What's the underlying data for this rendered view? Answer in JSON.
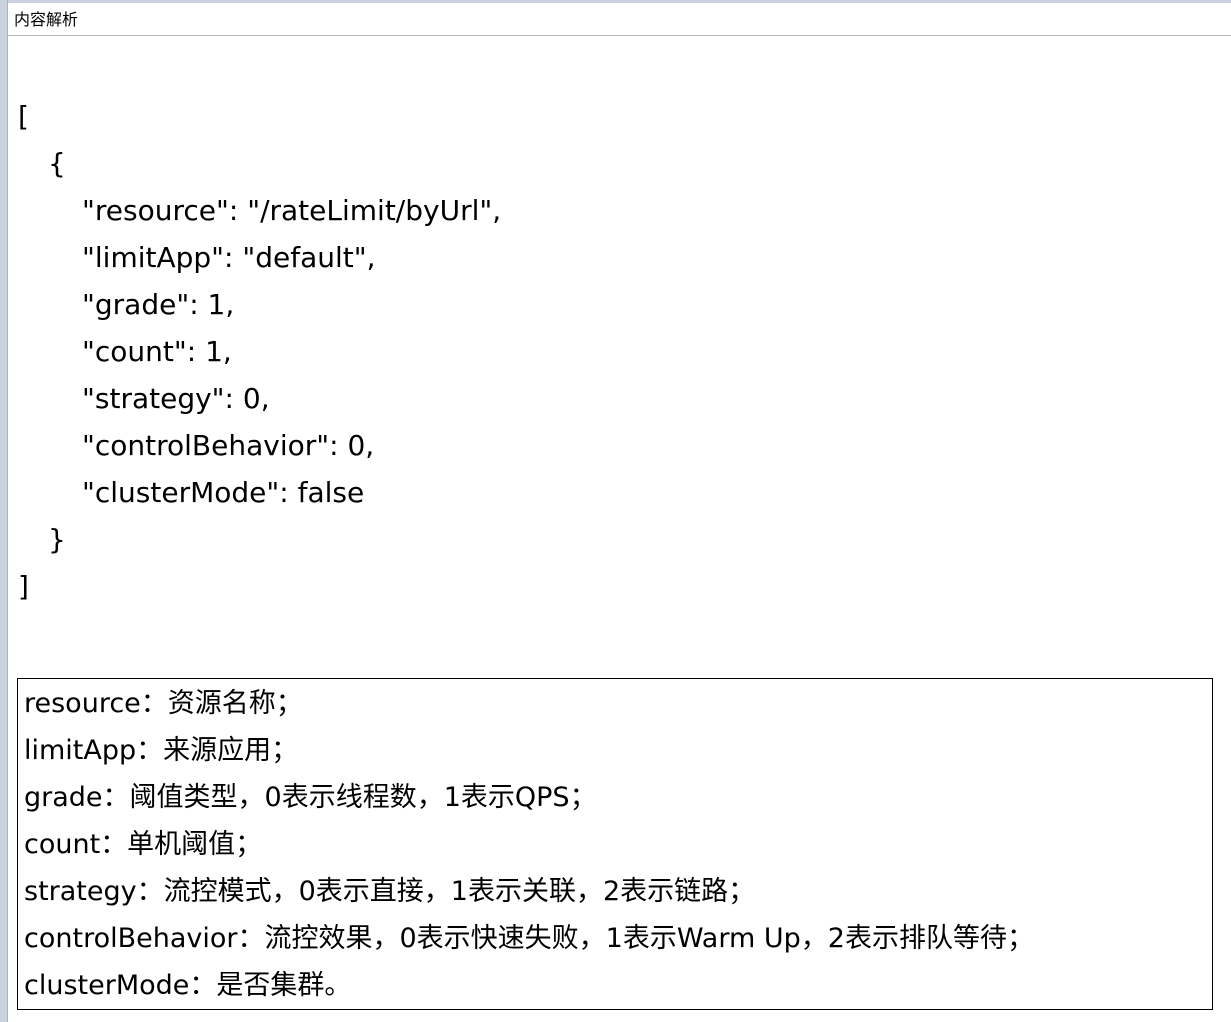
{
  "header": {
    "title": "内容解析"
  },
  "json_lines": [
    "[",
    "{",
    "\"resource\": \"/rateLimit/byUrl\",",
    "\"limitApp\": \"default\",",
    "\"grade\": 1,",
    "\"count\": 1,",
    "\"strategy\": 0,",
    "\"controlBehavior\": 0,",
    "\"clusterMode\": false",
    "}",
    "]"
  ],
  "descriptions": [
    "resource：资源名称；",
    "limitApp：来源应用；",
    "grade：阈值类型，0表示线程数，1表示QPS；",
    "count：单机阈值；",
    "strategy：流控模式，0表示直接，1表示关联，2表示链路；",
    "controlBehavior：流控效果，0表示快速失败，1表示Warm Up，2表示排队等待；",
    "clusterMode：是否集群。"
  ]
}
